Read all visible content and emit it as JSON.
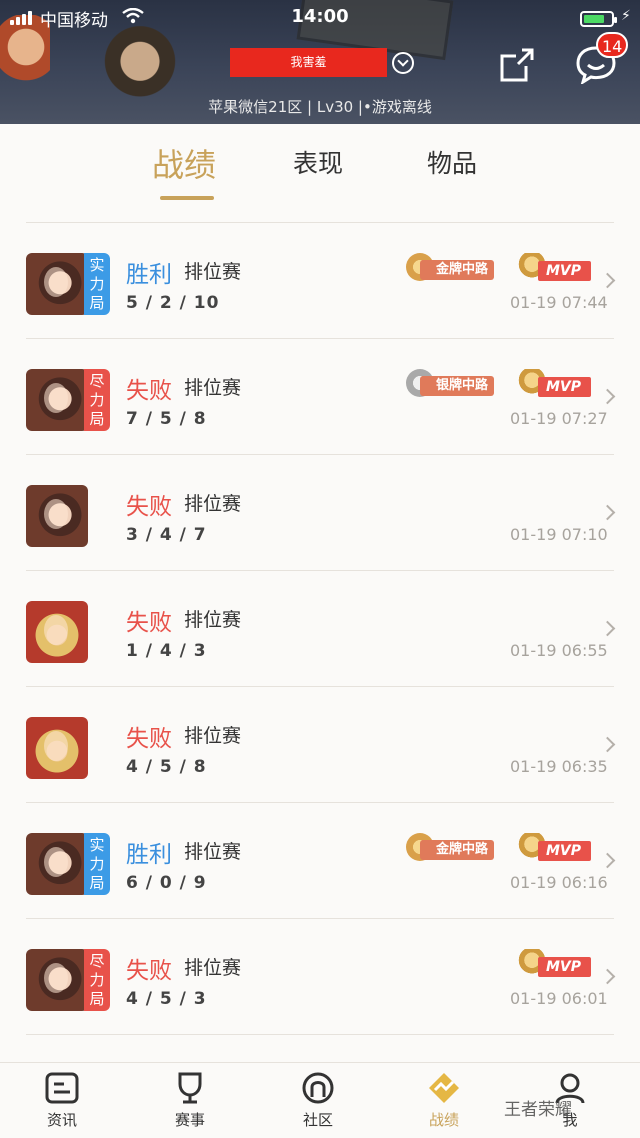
{
  "status_bar": {
    "carrier": "中国移动",
    "time": "14:00",
    "battery_level": 0.75
  },
  "header": {
    "player_name": "我害羞",
    "account_info": "苹果微信21区 | Lv30 |•游戏离线",
    "message_badge": "14",
    "icons": [
      "share-icon",
      "message-icon",
      "chevron-down-icon"
    ]
  },
  "tabs": [
    {
      "label": "战绩",
      "active": true
    },
    {
      "label": "表现",
      "active": false
    },
    {
      "label": "物品",
      "active": false
    }
  ],
  "matches": [
    {
      "hero": "female",
      "tag": "实力局",
      "tag_color": "blue",
      "result": "胜利",
      "outcome": "win",
      "mode": "排位赛",
      "kda": "5 / 2 / 10",
      "time": "01-19 07:44",
      "medal": "金牌中路",
      "medal_type": "gold",
      "mvp": "MVP"
    },
    {
      "hero": "female",
      "tag": "尽力局",
      "tag_color": "red",
      "result": "失败",
      "outcome": "lose",
      "mode": "排位赛",
      "kda": "7 / 5 / 8",
      "time": "01-19 07:27",
      "medal": "银牌中路",
      "medal_type": "silver",
      "mvp": "MVP"
    },
    {
      "hero": "female",
      "tag": "",
      "tag_color": "",
      "result": "失败",
      "outcome": "lose",
      "mode": "排位赛",
      "kda": "3 / 4 / 7",
      "time": "01-19 07:10",
      "medal": "",
      "medal_type": "",
      "mvp": ""
    },
    {
      "hero": "blonde",
      "tag": "",
      "tag_color": "",
      "result": "失败",
      "outcome": "lose",
      "mode": "排位赛",
      "kda": "1 / 4 / 3",
      "time": "01-19 06:55",
      "medal": "",
      "medal_type": "",
      "mvp": ""
    },
    {
      "hero": "blonde",
      "tag": "",
      "tag_color": "",
      "result": "失败",
      "outcome": "lose",
      "mode": "排位赛",
      "kda": "4 / 5 / 8",
      "time": "01-19 06:35",
      "medal": "",
      "medal_type": "",
      "mvp": ""
    },
    {
      "hero": "female",
      "tag": "实力局",
      "tag_color": "blue",
      "result": "胜利",
      "outcome": "win",
      "mode": "排位赛",
      "kda": "6 / 0 / 9",
      "time": "01-19 06:16",
      "medal": "金牌中路",
      "medal_type": "gold",
      "mvp": "MVP"
    },
    {
      "hero": "female",
      "tag": "尽力局",
      "tag_color": "red",
      "result": "失败",
      "outcome": "lose",
      "mode": "排位赛",
      "kda": "4 / 5 / 3",
      "time": "01-19 06:01",
      "medal": "",
      "medal_type": "",
      "mvp": "MVP"
    }
  ],
  "nav": [
    {
      "label": "资讯",
      "icon": "news-icon",
      "active": false
    },
    {
      "label": "赛事",
      "icon": "trophy-icon",
      "active": false
    },
    {
      "label": "社区",
      "icon": "community-icon",
      "active": false
    },
    {
      "label": "战绩",
      "icon": "stats-icon",
      "active": true
    },
    {
      "label": "我",
      "icon": "profile-icon",
      "active": false
    }
  ],
  "watermark": "王者荣耀",
  "colors": {
    "gold_accent": "#c8a25a",
    "win": "#3a8fde",
    "lose": "#e8524a",
    "brand_red": "#e8281e"
  }
}
